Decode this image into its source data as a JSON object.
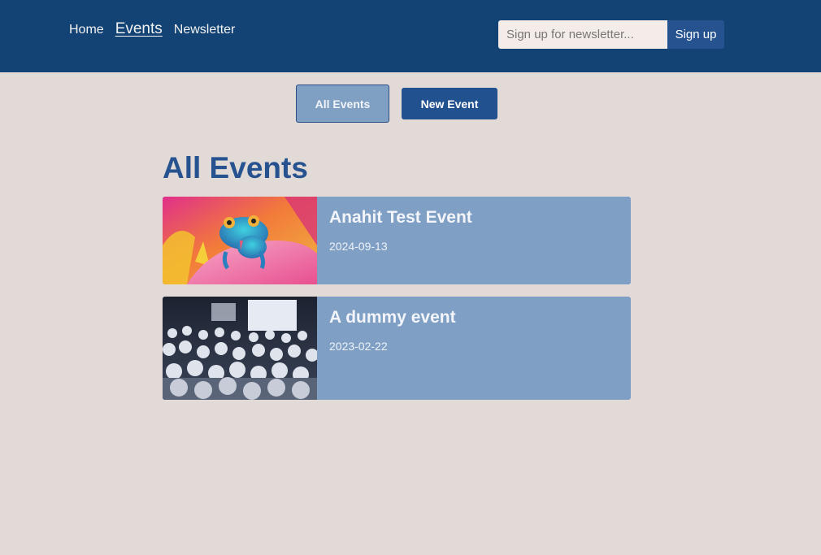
{
  "nav": {
    "items": [
      {
        "label": "Home",
        "active": false
      },
      {
        "label": "Events",
        "active": true
      },
      {
        "label": "Newsletter",
        "active": false
      }
    ]
  },
  "newsletter": {
    "placeholder": "Sign up for newsletter...",
    "value": "",
    "button_label": "Sign up"
  },
  "subnav": {
    "all_events_label": "All Events",
    "new_event_label": "New Event"
  },
  "page": {
    "title": "All Events"
  },
  "events": [
    {
      "title": "Anahit Test Event",
      "date": "2024-09-13",
      "image": "chameleon-on-flower-image"
    },
    {
      "title": "A dummy event",
      "date": "2023-02-22",
      "image": "conference-audience-image"
    }
  ],
  "colors": {
    "header_bg": "#134375",
    "page_bg": "#e2dad7",
    "accent": "#26538f",
    "card_bg": "#7fa0c4"
  }
}
